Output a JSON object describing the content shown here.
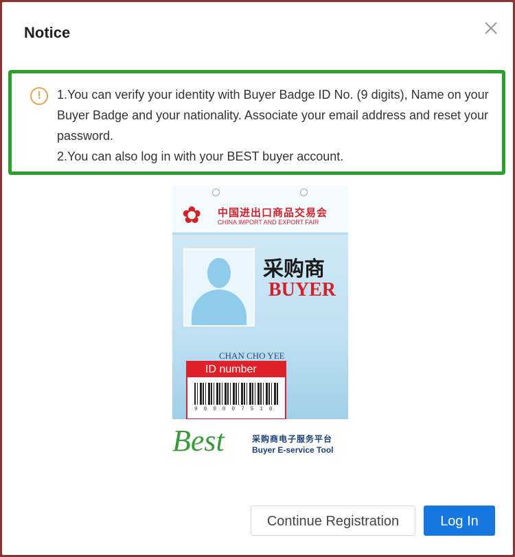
{
  "dialog": {
    "title": "Notice",
    "close_icon": "close-icon"
  },
  "notice": {
    "icon": "exclamation-circle-icon",
    "line1": "1.You can verify your identity with Buyer Badge ID No. (9 digits), Name on your Buyer Badge and your nationality. Associate your email address and reset your password.",
    "line2": "2.You can also log in with your BEST buyer account.",
    "highlight_color": "#2ca02c"
  },
  "badge": {
    "fair_cn": "中国进出口商品交易会",
    "fair_en": "CHINA IMPORT AND EXPORT FAIR",
    "role_cn": "采购商",
    "role_en": "BUYER",
    "holder_name": "CHAN CHO YEE",
    "id_label": "ID number",
    "barcode_number": "9 0 0 0 0 7 5 1 0"
  },
  "best_logo": {
    "word": "Best",
    "cn": "采购商电子服务平台",
    "en": "Buyer E-service Tool"
  },
  "actions": {
    "continue_label": "Continue Registration",
    "login_label": "Log In",
    "primary_color": "#1677e0"
  }
}
